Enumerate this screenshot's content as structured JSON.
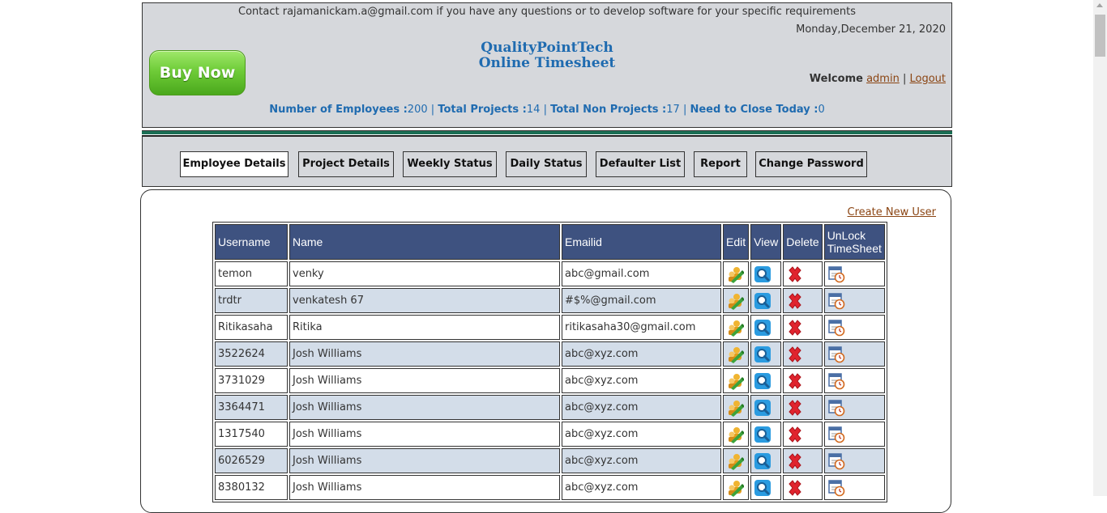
{
  "header": {
    "contact": "Contact rajamanickam.a@gmail.com if you have any questions or to develop software for your specific requirements",
    "date": "Monday,December 21, 2020",
    "brand_line1": "QualityPointTech",
    "brand_line2": "Online Timesheet",
    "buy_now": "Buy Now",
    "welcome_label": "Welcome",
    "user": "admin",
    "sep": "|",
    "logout": "Logout"
  },
  "stats": {
    "employees_label": "Number of Employees :",
    "employees": "200",
    "projects_label": "Total Projects :",
    "projects": "14",
    "nonprojects_label": "Total Non Projects :",
    "nonprojects": "17",
    "close_label": "Need to Close Today :",
    "close": "0",
    "sep": "|"
  },
  "nav": {
    "tabs": [
      {
        "label": "Employee Details",
        "active": true
      },
      {
        "label": "Project Details"
      },
      {
        "label": "Weekly Status"
      },
      {
        "label": "Daily Status"
      },
      {
        "label": "Defaulter List"
      },
      {
        "label": "Report"
      },
      {
        "label": "Change Password"
      }
    ]
  },
  "content": {
    "create_new_user": "Create New User",
    "columns": [
      "Username",
      "Name",
      "Emailid",
      "Edit",
      "View",
      "Delete",
      "UnLock TimeSheet"
    ],
    "rows": [
      {
        "username": "temon",
        "name": "venky",
        "email": "abc@gmail.com"
      },
      {
        "username": "trdtr",
        "name": "venkatesh 67",
        "email": "#$%@gmail.com"
      },
      {
        "username": "Ritikasaha",
        "name": "Ritika",
        "email": "ritikasaha30@gmail.com"
      },
      {
        "username": "3522624",
        "name": "Josh Williams",
        "email": "abc@xyz.com"
      },
      {
        "username": "3731029",
        "name": "Josh Williams",
        "email": "abc@xyz.com"
      },
      {
        "username": "3364471",
        "name": "Josh Williams",
        "email": "abc@xyz.com"
      },
      {
        "username": "1317540",
        "name": "Josh Williams",
        "email": "abc@xyz.com"
      },
      {
        "username": "6026529",
        "name": "Josh Williams",
        "email": "abc@xyz.com"
      },
      {
        "username": "8380132",
        "name": "Josh Williams",
        "email": "abc@xyz.com"
      }
    ],
    "icons": {
      "edit": "edit-user-icon",
      "view": "view-magnifier-icon",
      "delete": "delete-x-icon",
      "unlock": "unlock-timesheet-icon"
    }
  },
  "colors": {
    "header_bg": "#d6d8dc",
    "table_header": "#3e5280",
    "row_alt": "#d3dde9",
    "brand": "#1f6bb0",
    "link": "#8b4513"
  }
}
